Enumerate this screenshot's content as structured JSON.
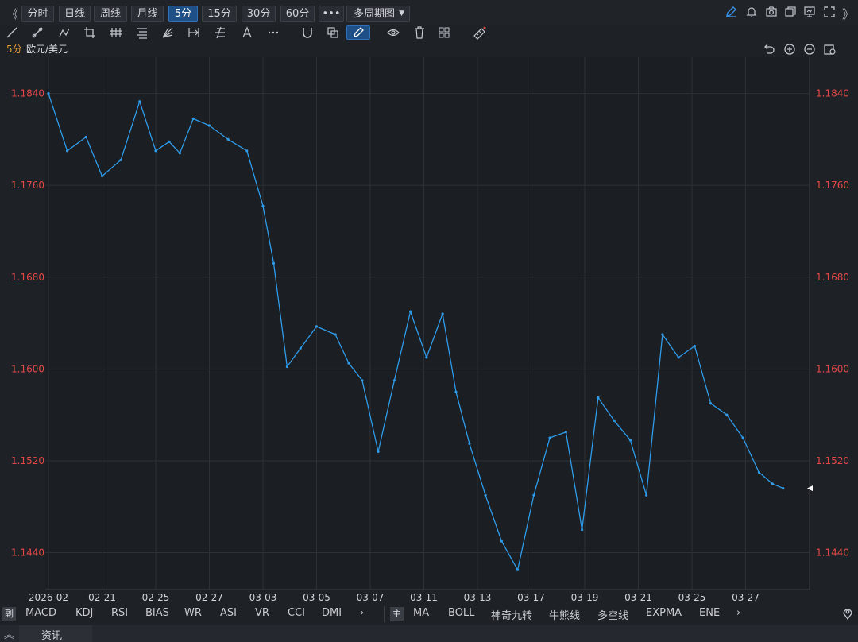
{
  "toolbar": {
    "collapse_left": "《",
    "collapse_right": "》",
    "periods": [
      {
        "label": "分时",
        "active": false
      },
      {
        "label": "日线",
        "active": false
      },
      {
        "label": "周线",
        "active": false
      },
      {
        "label": "月线",
        "active": false
      },
      {
        "label": "5分",
        "active": true
      },
      {
        "label": "15分",
        "active": false
      },
      {
        "label": "30分",
        "active": false
      },
      {
        "label": "60分",
        "active": false
      }
    ],
    "more_label": "•••",
    "multi_period_label": "多周期图",
    "right_icons": [
      "pencil-icon",
      "bell-icon",
      "camera-icon",
      "copy-icon",
      "monitor-icon",
      "fullscreen-icon"
    ]
  },
  "draw_tools": [
    "line-tool-icon",
    "ray-tool-icon",
    "polyline-tool-icon",
    "crop-tool-icon",
    "parallel-channel-icon",
    "fib-retracement-icon",
    "gann-fan-icon",
    "range-tool-icon",
    "pitchfork-icon",
    "text-tool-icon",
    "more-tools-icon",
    "magnet-icon",
    "layers-icon",
    "brush-icon",
    "eye-icon",
    "trash-icon",
    "group-icon",
    "ruler-icon"
  ],
  "chart_header": {
    "period": "5分",
    "symbol": "欧元/美元"
  },
  "chart_controls": [
    "undo-icon",
    "zoom-in-icon",
    "zoom-out-icon",
    "settings-icon"
  ],
  "indicators": {
    "sub_tag": "副",
    "sub": [
      "MACD",
      "KDJ",
      "RSI",
      "BIAS",
      "WR",
      "ASI",
      "VR",
      "CCI",
      "DMI"
    ],
    "main_tag": "主",
    "main": [
      "MA",
      "BOLL",
      "神奇九转",
      "牛熊线",
      "多空线",
      "EXPMA",
      "ENE"
    ],
    "next_arrow": "›"
  },
  "news": {
    "toggle": "︽",
    "label": "资讯"
  },
  "colors": {
    "line": "#2f9be8",
    "axis_text": "#e04848",
    "grid": "#2c3037",
    "background": "#1e2126"
  },
  "chart_data": {
    "type": "line",
    "ylim": [
      1.1412,
      1.1866
    ],
    "yticks": [
      "1.1840",
      "1.1760",
      "1.1680",
      "1.1600",
      "1.1520",
      "1.1440"
    ],
    "xticks": [
      "2026-02",
      "02-21",
      "02-25",
      "02-27",
      "03-03",
      "03-05",
      "03-07",
      "03-11",
      "03-13",
      "03-17",
      "03-19",
      "03-21",
      "03-25",
      "03-27"
    ],
    "x": [
      0,
      0.35,
      0.7,
      1.0,
      1.35,
      1.7,
      2.0,
      2.25,
      2.45,
      2.7,
      3.0,
      3.35,
      3.7,
      4.0,
      4.2,
      4.45,
      4.7,
      5.0,
      5.35,
      5.6,
      5.85,
      6.15,
      6.45,
      6.75,
      7.05,
      7.35,
      7.6,
      7.85,
      8.15,
      8.45,
      8.75,
      9.05,
      9.35,
      9.65,
      9.95,
      10.25,
      10.55,
      10.85,
      11.15,
      11.45,
      11.75,
      12.05,
      12.35,
      12.65,
      12.95,
      13.25,
      13.5,
      13.7
    ],
    "y": [
      1.184,
      1.179,
      1.1802,
      1.1768,
      1.1782,
      1.1833,
      1.179,
      1.1798,
      1.1788,
      1.1818,
      1.1812,
      1.18,
      1.179,
      1.1742,
      1.1692,
      1.1602,
      1.1618,
      1.1637,
      1.163,
      1.1605,
      1.159,
      1.1528,
      1.159,
      1.165,
      1.161,
      1.1648,
      1.158,
      1.1535,
      1.149,
      1.145,
      1.1425,
      1.149,
      1.154,
      1.1545,
      1.146,
      1.1575,
      1.1555,
      1.1538,
      1.149,
      1.163,
      1.161,
      1.162,
      1.157,
      1.156,
      1.154,
      1.151,
      1.15,
      1.1496
    ],
    "last_value": 1.1496
  }
}
